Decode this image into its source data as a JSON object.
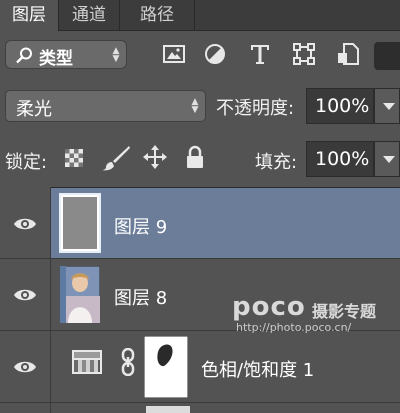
{
  "tabs": [
    "图层",
    "通道",
    "路径"
  ],
  "filter": {
    "kind_label": "类型"
  },
  "blend": {
    "mode": "柔光",
    "opacity_label": "不透明度:",
    "opacity_value": "100%",
    "lock_label": "锁定:",
    "fill_label": "填充:",
    "fill_value": "100%"
  },
  "layers": [
    {
      "name": "图层 9",
      "selected": true
    },
    {
      "name": "图层 8",
      "selected": false
    },
    {
      "name": "色相/饱和度 1",
      "selected": false
    }
  ],
  "watermark": {
    "brand": "poco",
    "title": "摄影专题",
    "url": "http://photo.poco.cn/"
  },
  "colors": {
    "panel": "#535353",
    "selected_row": "#6b7d99",
    "tabbar": "#3c3c3c"
  }
}
